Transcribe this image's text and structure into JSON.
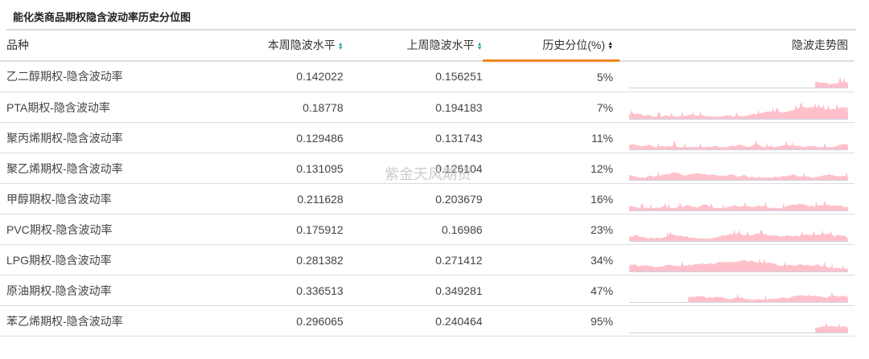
{
  "title": "能化类商品期权隐含波动率历史分位图",
  "headers": {
    "name": "品种",
    "this_week": "本周隐波水平",
    "last_week": "上周隐波水平",
    "percentile": "历史分位(%)",
    "trend": "隐波走势图"
  },
  "watermark": "紫金天风期货",
  "colors": {
    "spark": "#ffc0cb",
    "active_sort": "#f08519",
    "sort_icon": "#1aa59a"
  },
  "rows": [
    {
      "name": "乙二醇期权-隐含波动率",
      "this_week": "0.142022",
      "last_week": "0.156251",
      "percentile": "5%",
      "spark_start": 0.85
    },
    {
      "name": "PTA期权-隐含波动率",
      "this_week": "0.18778",
      "last_week": "0.194183",
      "percentile": "7%",
      "spark_start": 0.0
    },
    {
      "name": "聚丙烯期权-隐含波动率",
      "this_week": "0.129486",
      "last_week": "0.131743",
      "percentile": "11%",
      "spark_start": 0.0
    },
    {
      "name": "聚乙烯期权-隐含波动率",
      "this_week": "0.131095",
      "last_week": "0.126104",
      "percentile": "12%",
      "spark_start": 0.0
    },
    {
      "name": "甲醇期权-隐含波动率",
      "this_week": "0.211628",
      "last_week": "0.203679",
      "percentile": "16%",
      "spark_start": 0.0
    },
    {
      "name": "PVC期权-隐含波动率",
      "this_week": "0.175912",
      "last_week": "0.16986",
      "percentile": "23%",
      "spark_start": 0.0
    },
    {
      "name": "LPG期权-隐含波动率",
      "this_week": "0.281382",
      "last_week": "0.271412",
      "percentile": "34%",
      "spark_start": 0.0
    },
    {
      "name": "原油期权-隐含波动率",
      "this_week": "0.336513",
      "last_week": "0.349281",
      "percentile": "47%",
      "spark_start": 0.27
    },
    {
      "name": "苯乙烯期权-隐含波动率",
      "this_week": "0.296065",
      "last_week": "0.240464",
      "percentile": "95%",
      "spark_start": 0.85
    }
  ]
}
